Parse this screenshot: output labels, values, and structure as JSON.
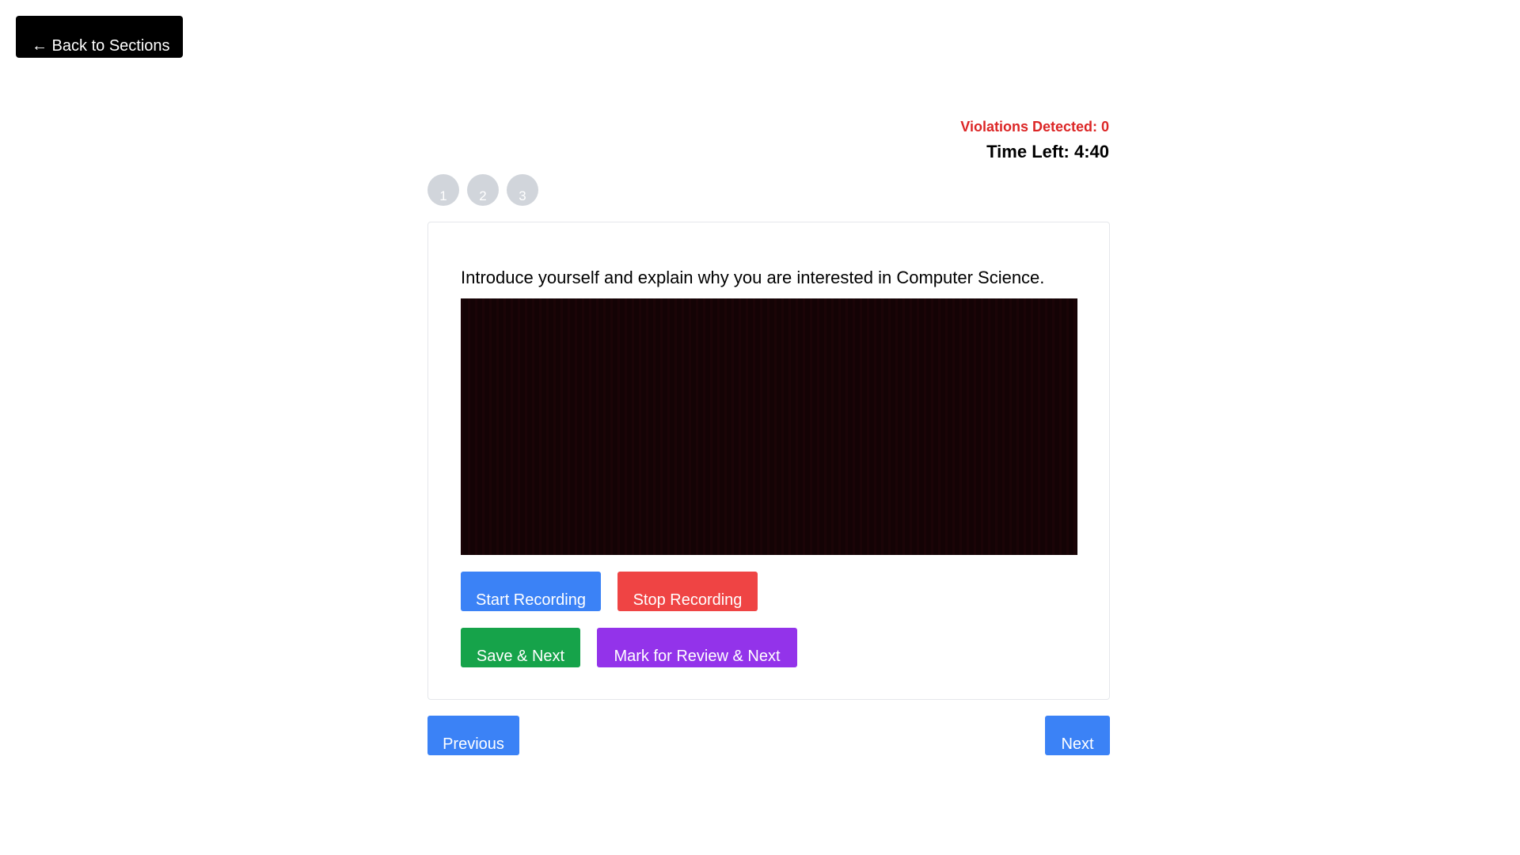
{
  "header": {
    "back_label": "← Back to Sections"
  },
  "status": {
    "violations": "Violations Detected: 0",
    "time_left": "Time Left: 4:40"
  },
  "question_nav": [
    "1",
    "2",
    "3"
  ],
  "question": {
    "text": "Introduce yourself and explain why you are interested in Computer Science."
  },
  "recording": {
    "start_label": "Start Recording",
    "stop_label": "Stop Recording"
  },
  "actions": {
    "save_next_label": "Save & Next",
    "review_next_label": "Mark for Review & Next"
  },
  "pagination": {
    "previous_label": "Previous",
    "next_label": "Next"
  },
  "colors": {
    "primary": "#3b82f6",
    "danger": "#ef4444",
    "success": "#16a34a",
    "review": "#9333ea",
    "violation_text": "#dc2626",
    "question_nav_inactive": "#d1d5db"
  }
}
